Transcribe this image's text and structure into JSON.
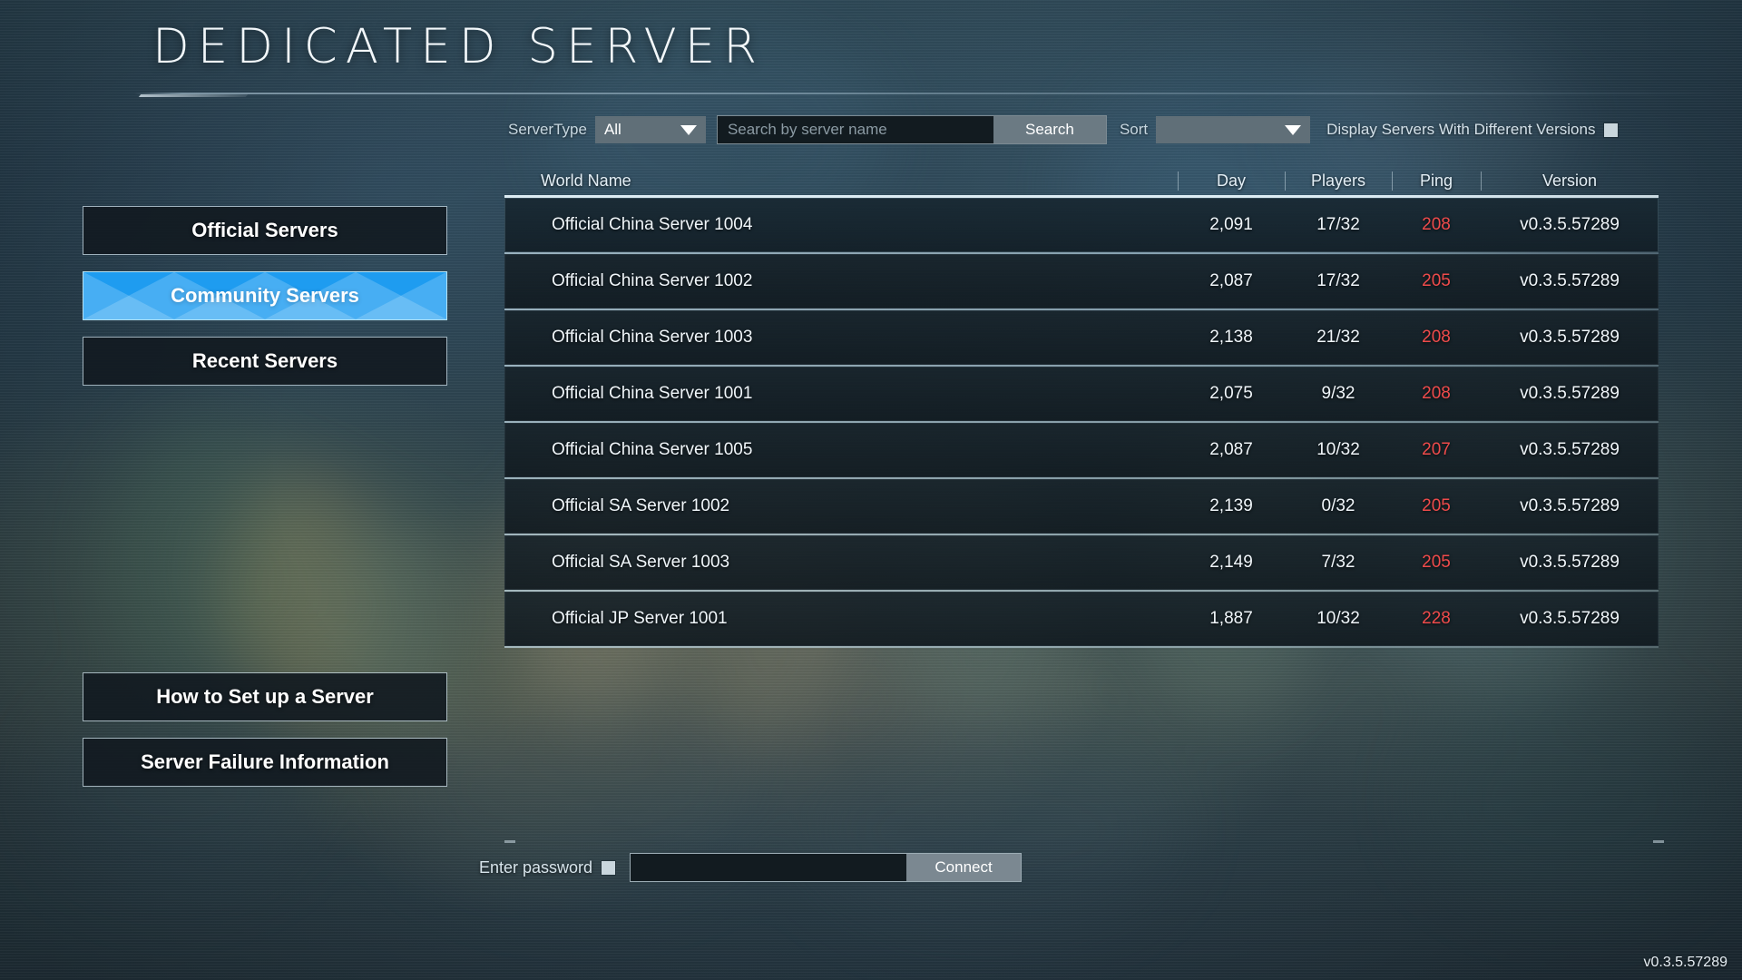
{
  "header": {
    "title": "DEDICATED SERVER"
  },
  "toolbar": {
    "server_type_label": "ServerType",
    "server_type_value": "All",
    "search_placeholder": "Search by server name",
    "search_value": "",
    "search_button": "Search",
    "sort_label": "Sort",
    "sort_value": "",
    "different_versions_label": "Display Servers With Different Versions",
    "different_versions_checked": false
  },
  "sidebar": {
    "tabs": [
      {
        "label": "Official Servers",
        "selected": false
      },
      {
        "label": "Community Servers",
        "selected": true
      },
      {
        "label": "Recent Servers",
        "selected": false
      }
    ],
    "links": [
      {
        "label": "How to Set up a Server"
      },
      {
        "label": "Server Failure Information"
      }
    ]
  },
  "table": {
    "columns": [
      "World Name",
      "Day",
      "Players",
      "Ping",
      "Version"
    ],
    "rows": [
      {
        "world": "Official China Server 1004",
        "day": "2,091",
        "players": "17/32",
        "ping": "208",
        "version": "v0.3.5.57289"
      },
      {
        "world": "Official China Server 1002",
        "day": "2,087",
        "players": "17/32",
        "ping": "205",
        "version": "v0.3.5.57289"
      },
      {
        "world": "Official China Server 1003",
        "day": "2,138",
        "players": "21/32",
        "ping": "208",
        "version": "v0.3.5.57289"
      },
      {
        "world": "Official China Server 1001",
        "day": "2,075",
        "players": "9/32",
        "ping": "208",
        "version": "v0.3.5.57289"
      },
      {
        "world": "Official China Server 1005",
        "day": "2,087",
        "players": "10/32",
        "ping": "207",
        "version": "v0.3.5.57289"
      },
      {
        "world": "Official SA Server 1002",
        "day": "2,139",
        "players": "0/32",
        "ping": "205",
        "version": "v0.3.5.57289"
      },
      {
        "world": "Official SA Server 1003",
        "day": "2,149",
        "players": "7/32",
        "ping": "205",
        "version": "v0.3.5.57289"
      },
      {
        "world": "Official JP Server 1001",
        "day": "1,887",
        "players": "10/32",
        "ping": "228",
        "version": "v0.3.5.57289"
      }
    ]
  },
  "footer": {
    "password_label": "Enter password",
    "password_checked": false,
    "password_value": "",
    "password_placeholder": "",
    "connect_button": "Connect"
  },
  "build_version": "v0.3.5.57289",
  "colors": {
    "accent_blue": "#1e9cf0",
    "selection_bracket": "#21b7f5",
    "ping_red": "#ef4b4b",
    "panel_dark": "#121a20",
    "control_grey": "#606f78"
  }
}
